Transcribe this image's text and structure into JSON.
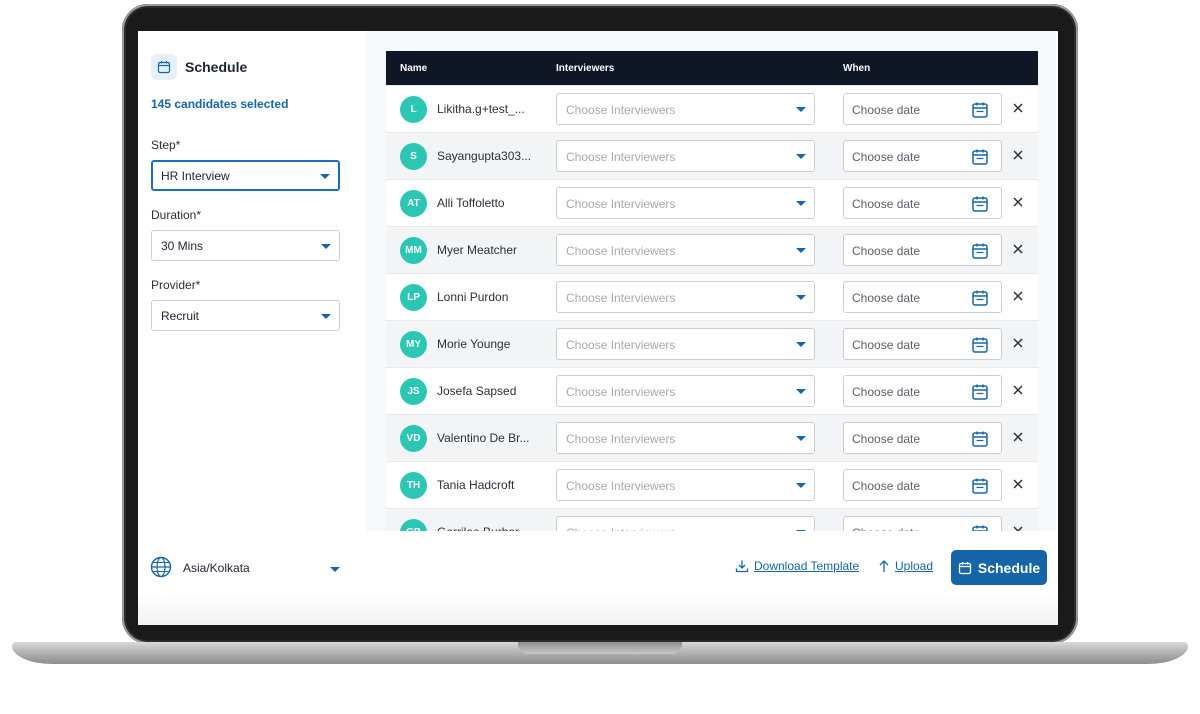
{
  "sidebar": {
    "title": "Schedule",
    "selected_count": "145 candidates selected",
    "step": {
      "label": "Step*",
      "value": "HR Interview"
    },
    "duration": {
      "label": "Duration*",
      "value": "30 Mins"
    },
    "provider": {
      "label": "Provider*",
      "value": "Recruit"
    }
  },
  "table": {
    "headers": {
      "name": "Name",
      "interviewers": "Interviewers",
      "when": "When"
    },
    "rows": [
      {
        "initials": "L",
        "name": "Likitha.g+test_...",
        "interviewers_placeholder": "Choose Interviewers",
        "date_placeholder": "Choose date"
      },
      {
        "initials": "S",
        "name": "Sayangupta303...",
        "interviewers_placeholder": "Choose Interviewers",
        "date_placeholder": "Choose date"
      },
      {
        "initials": "AT",
        "name": "Alli Toffoletto",
        "interviewers_placeholder": "Choose Interviewers",
        "date_placeholder": "Choose date"
      },
      {
        "initials": "MM",
        "name": "Myer Meatcher",
        "interviewers_placeholder": "Choose Interviewers",
        "date_placeholder": "Choose date"
      },
      {
        "initials": "LP",
        "name": "Lonni Purdon",
        "interviewers_placeholder": "Choose Interviewers",
        "date_placeholder": "Choose date"
      },
      {
        "initials": "MY",
        "name": "Morie Younge",
        "interviewers_placeholder": "Choose Interviewers",
        "date_placeholder": "Choose date"
      },
      {
        "initials": "JS",
        "name": "Josefa Sapsed",
        "interviewers_placeholder": "Choose Interviewers",
        "date_placeholder": "Choose date"
      },
      {
        "initials": "VD",
        "name": "Valentino De Br...",
        "interviewers_placeholder": "Choose Interviewers",
        "date_placeholder": "Choose date"
      },
      {
        "initials": "TH",
        "name": "Tania Hadcroft",
        "interviewers_placeholder": "Choose Interviewers",
        "date_placeholder": "Choose date"
      },
      {
        "initials": "GB",
        "name": "Gerrilee Burbor",
        "interviewers_placeholder": "Choose Interviewers",
        "date_placeholder": "Choose date"
      }
    ]
  },
  "footer": {
    "timezone": "Asia/Kolkata",
    "download_template": "Download Template",
    "upload": "Upload",
    "schedule_button": "Schedule"
  },
  "colors": {
    "accent": "#1565a8",
    "avatar": "#2bc7b4",
    "table_header": "#0f1626"
  },
  "icons": [
    "calendar-icon",
    "globe-icon",
    "download-icon",
    "upload-icon",
    "close-icon",
    "chevron-down-icon"
  ]
}
